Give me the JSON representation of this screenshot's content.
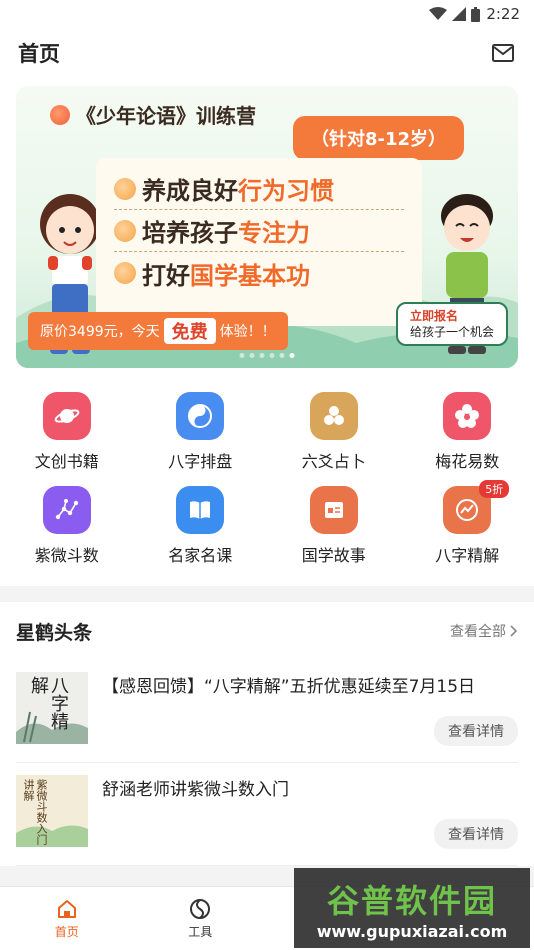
{
  "status": {
    "time": "2:22"
  },
  "header": {
    "title": "首页",
    "mail_icon": "mail-icon"
  },
  "banner": {
    "camp_title": "《少年论语》训练营",
    "age": "（针对8-12岁）",
    "lines": [
      {
        "a": "养成良好",
        "b": "行为习惯"
      },
      {
        "a": "培养孩子",
        "b": "专注力"
      },
      {
        "a": "打好",
        "b": "国学基本功"
      }
    ],
    "price_a": "原价3499元，今天",
    "price_free": "免费",
    "price_b": "体验！！",
    "signup_a": "立即报名",
    "signup_b": "给孩子一个机会",
    "page_count": 6,
    "active_page": 5
  },
  "tools": [
    {
      "label": "文创书籍",
      "color": "#f0566a",
      "icon": "planet-icon"
    },
    {
      "label": "八字排盘",
      "color": "#4a8df0",
      "icon": "yin-yang-icon"
    },
    {
      "label": "六爻占卜",
      "color": "#d9a55a",
      "icon": "coins-icon"
    },
    {
      "label": "梅花易数",
      "color": "#f0566a",
      "icon": "plum-blossom-icon"
    },
    {
      "label": "紫微斗数",
      "color": "#8a5cf0",
      "icon": "constellation-icon"
    },
    {
      "label": "名家名课",
      "color": "#3b8ef0",
      "icon": "book-icon"
    },
    {
      "label": "国学故事",
      "color": "#e9744a",
      "icon": "story-card-icon"
    },
    {
      "label": "八字精解",
      "color": "#e9744a",
      "icon": "chart-badge-icon",
      "badge": "5折"
    }
  ],
  "news": {
    "title": "星鹤头条",
    "more": "查看全部",
    "items": [
      {
        "text": "【感恩回馈】“八字精解”五折优惠延续至7月15日",
        "detail": "查看详情",
        "thumb": "八字精解"
      },
      {
        "text": "舒涵老师讲紫微斗数入门",
        "detail": "查看详情",
        "thumb": "紫微斗数入门讲解"
      }
    ]
  },
  "tabs": [
    {
      "label": "首页",
      "icon": "home-icon",
      "active": true
    },
    {
      "label": "工具",
      "icon": "compass-icon",
      "active": false
    }
  ],
  "watermark": {
    "brand": "谷普软件园",
    "url": "www.gupuxiazai.com"
  }
}
